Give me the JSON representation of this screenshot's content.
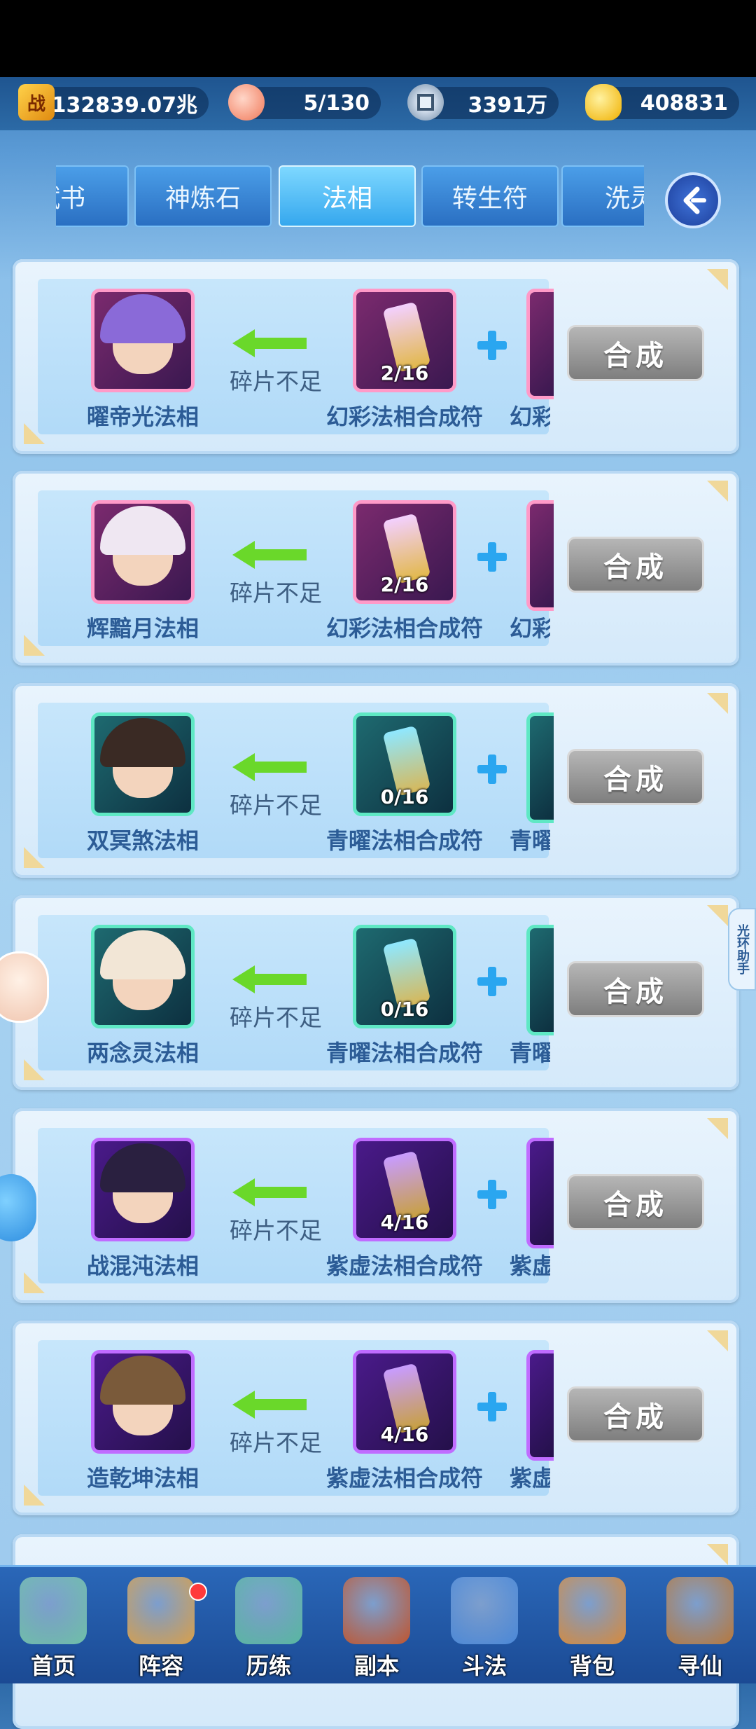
{
  "resources": {
    "power": {
      "icon": "battle-power-icon",
      "glyph": "战",
      "value": "132839.07兆"
    },
    "stamina": {
      "icon": "peach-icon",
      "value": "5/130"
    },
    "silver": {
      "icon": "coin-icon",
      "value": "3391万"
    },
    "gold": {
      "icon": "gold-ingot-icon",
      "value": "408831"
    }
  },
  "tabs": [
    {
      "label": "赋书",
      "active": false
    },
    {
      "label": "神炼石",
      "active": false
    },
    {
      "label": "法相",
      "active": true
    },
    {
      "label": "转生符",
      "active": false
    },
    {
      "label": "洗灵",
      "active": false
    }
  ],
  "back_icon": "back-arrow-icon",
  "recipes": [
    {
      "name": "曜帝光法相",
      "status": "碎片不足",
      "material": "幻彩法相合成符",
      "material_short": "幻彩",
      "count": "2/16",
      "rarity": "rainbow",
      "button": "合成"
    },
    {
      "name": "辉黯月法相",
      "status": "碎片不足",
      "material": "幻彩法相合成符",
      "material_short": "幻彩",
      "count": "2/16",
      "rarity": "rainbow",
      "button": "合成"
    },
    {
      "name": "双冥煞法相",
      "status": "碎片不足",
      "material": "青曜法相合成符",
      "material_short": "青曜",
      "count": "0/16",
      "rarity": "green",
      "button": "合成"
    },
    {
      "name": "两念灵法相",
      "status": "碎片不足",
      "material": "青曜法相合成符",
      "material_short": "青曜",
      "count": "0/16",
      "rarity": "green",
      "button": "合成"
    },
    {
      "name": "战混沌法相",
      "status": "碎片不足",
      "material": "紫虚法相合成符",
      "material_short": "紫虚",
      "count": "4/16",
      "rarity": "purple",
      "button": "合成"
    },
    {
      "name": "造乾坤法相",
      "status": "碎片不足",
      "material": "紫虚法相合成符",
      "material_short": "紫虚",
      "count": "4/16",
      "rarity": "purple",
      "button": "合成"
    }
  ],
  "side_helper": "光环助手",
  "nav": [
    {
      "label": "首页",
      "icon": "home-icon",
      "color": "#6fc0a8",
      "badge": false
    },
    {
      "label": "阵容",
      "icon": "lineup-icon",
      "color": "#d9a04a",
      "badge": true
    },
    {
      "label": "历练",
      "icon": "training-icon",
      "color": "#58b8a0",
      "badge": false
    },
    {
      "label": "副本",
      "icon": "dungeon-icon",
      "color": "#c0552e",
      "badge": false
    },
    {
      "label": "斗法",
      "icon": "battle-icon",
      "color": "#4a88d8",
      "badge": false
    },
    {
      "label": "背包",
      "icon": "bag-icon",
      "color": "#d88a3a",
      "badge": false
    },
    {
      "label": "寻仙",
      "icon": "seek-immortal-icon",
      "color": "#b8783a",
      "badge": false
    }
  ]
}
